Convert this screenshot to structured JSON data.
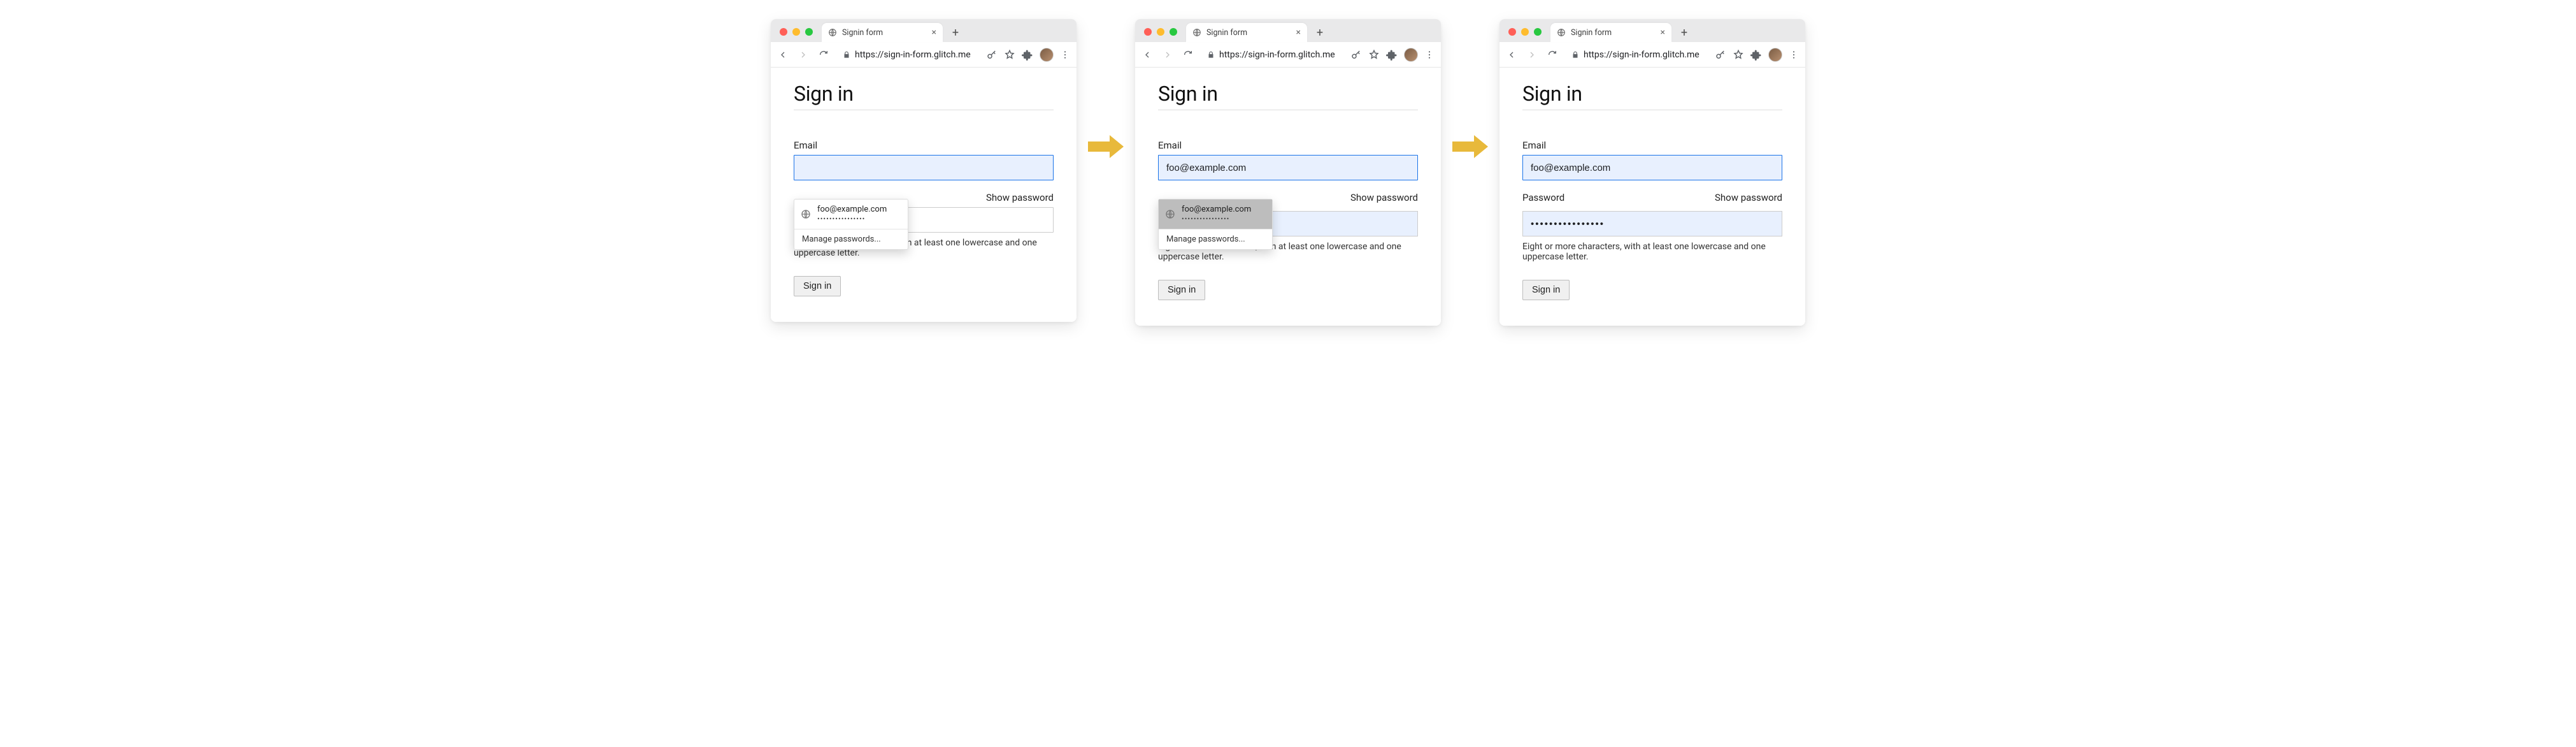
{
  "browser": {
    "tab_title": "Signin form",
    "url": "https://sign-in-form.glitch.me",
    "new_tab_tooltip": "New tab"
  },
  "page": {
    "heading": "Sign in",
    "email_label": "Email",
    "password_label": "Password",
    "show_password": "Show password",
    "hint": "Eight or more characters, with at least one lowercase and one uppercase letter.",
    "submit": "Sign in"
  },
  "autofill": {
    "suggestion_email": "foo@example.com",
    "suggestion_password_mask": "••••••••••••••••",
    "manage": "Manage passwords..."
  },
  "states": {
    "1": {
      "email_value": "",
      "password_value": "",
      "suggestion_selected": false,
      "show_autofill": true
    },
    "2": {
      "email_value": "foo@example.com",
      "password_value": "••••••••••••••••",
      "suggestion_selected": true,
      "show_autofill": true
    },
    "3": {
      "email_value": "foo@example.com",
      "password_value": "••••••••••••••••",
      "show_autofill": false
    }
  }
}
